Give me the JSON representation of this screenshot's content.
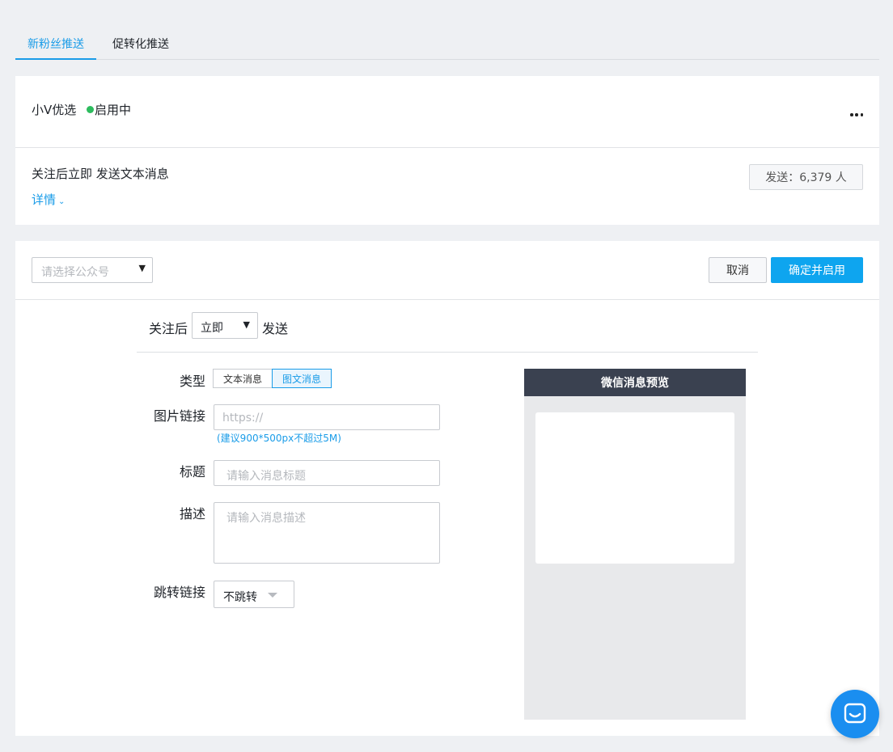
{
  "tabs": [
    {
      "label": "新粉丝推送",
      "active": true
    },
    {
      "label": "促转化推送",
      "active": false
    }
  ],
  "account_card": {
    "name": "小V优选",
    "status": "启用中",
    "status_color": "#2dbc5e",
    "rule": "关注后立即 发送文本消息",
    "detail_link": "详情",
    "sent_count": "发送：6,379 人"
  },
  "editor": {
    "account_select_placeholder": "请选择公众号",
    "cancel_label": "取消",
    "confirm_label": "确定并启用",
    "accent_color": "#0ea5ef",
    "follow_label": "关注后",
    "timing_value": "立即",
    "send_label": "发送",
    "fields": {
      "type_label": "类型",
      "type_options": [
        "文本消息",
        "图文消息"
      ],
      "type_selected": "图文消息",
      "image_link_label": "图片链接",
      "image_link_placeholder": "https://",
      "image_hint": "(建议900*500px不超过5M)",
      "title_label": "标题",
      "title_placeholder": "请输入消息标题",
      "desc_label": "描述",
      "desc_placeholder": "请输入消息描述",
      "jump_label": "跳转链接",
      "jump_value": "不跳转"
    },
    "preview_title": "微信消息预览"
  },
  "icons": {
    "more": "more-horizontal-icon",
    "chat": "chat-bubble-icon"
  }
}
